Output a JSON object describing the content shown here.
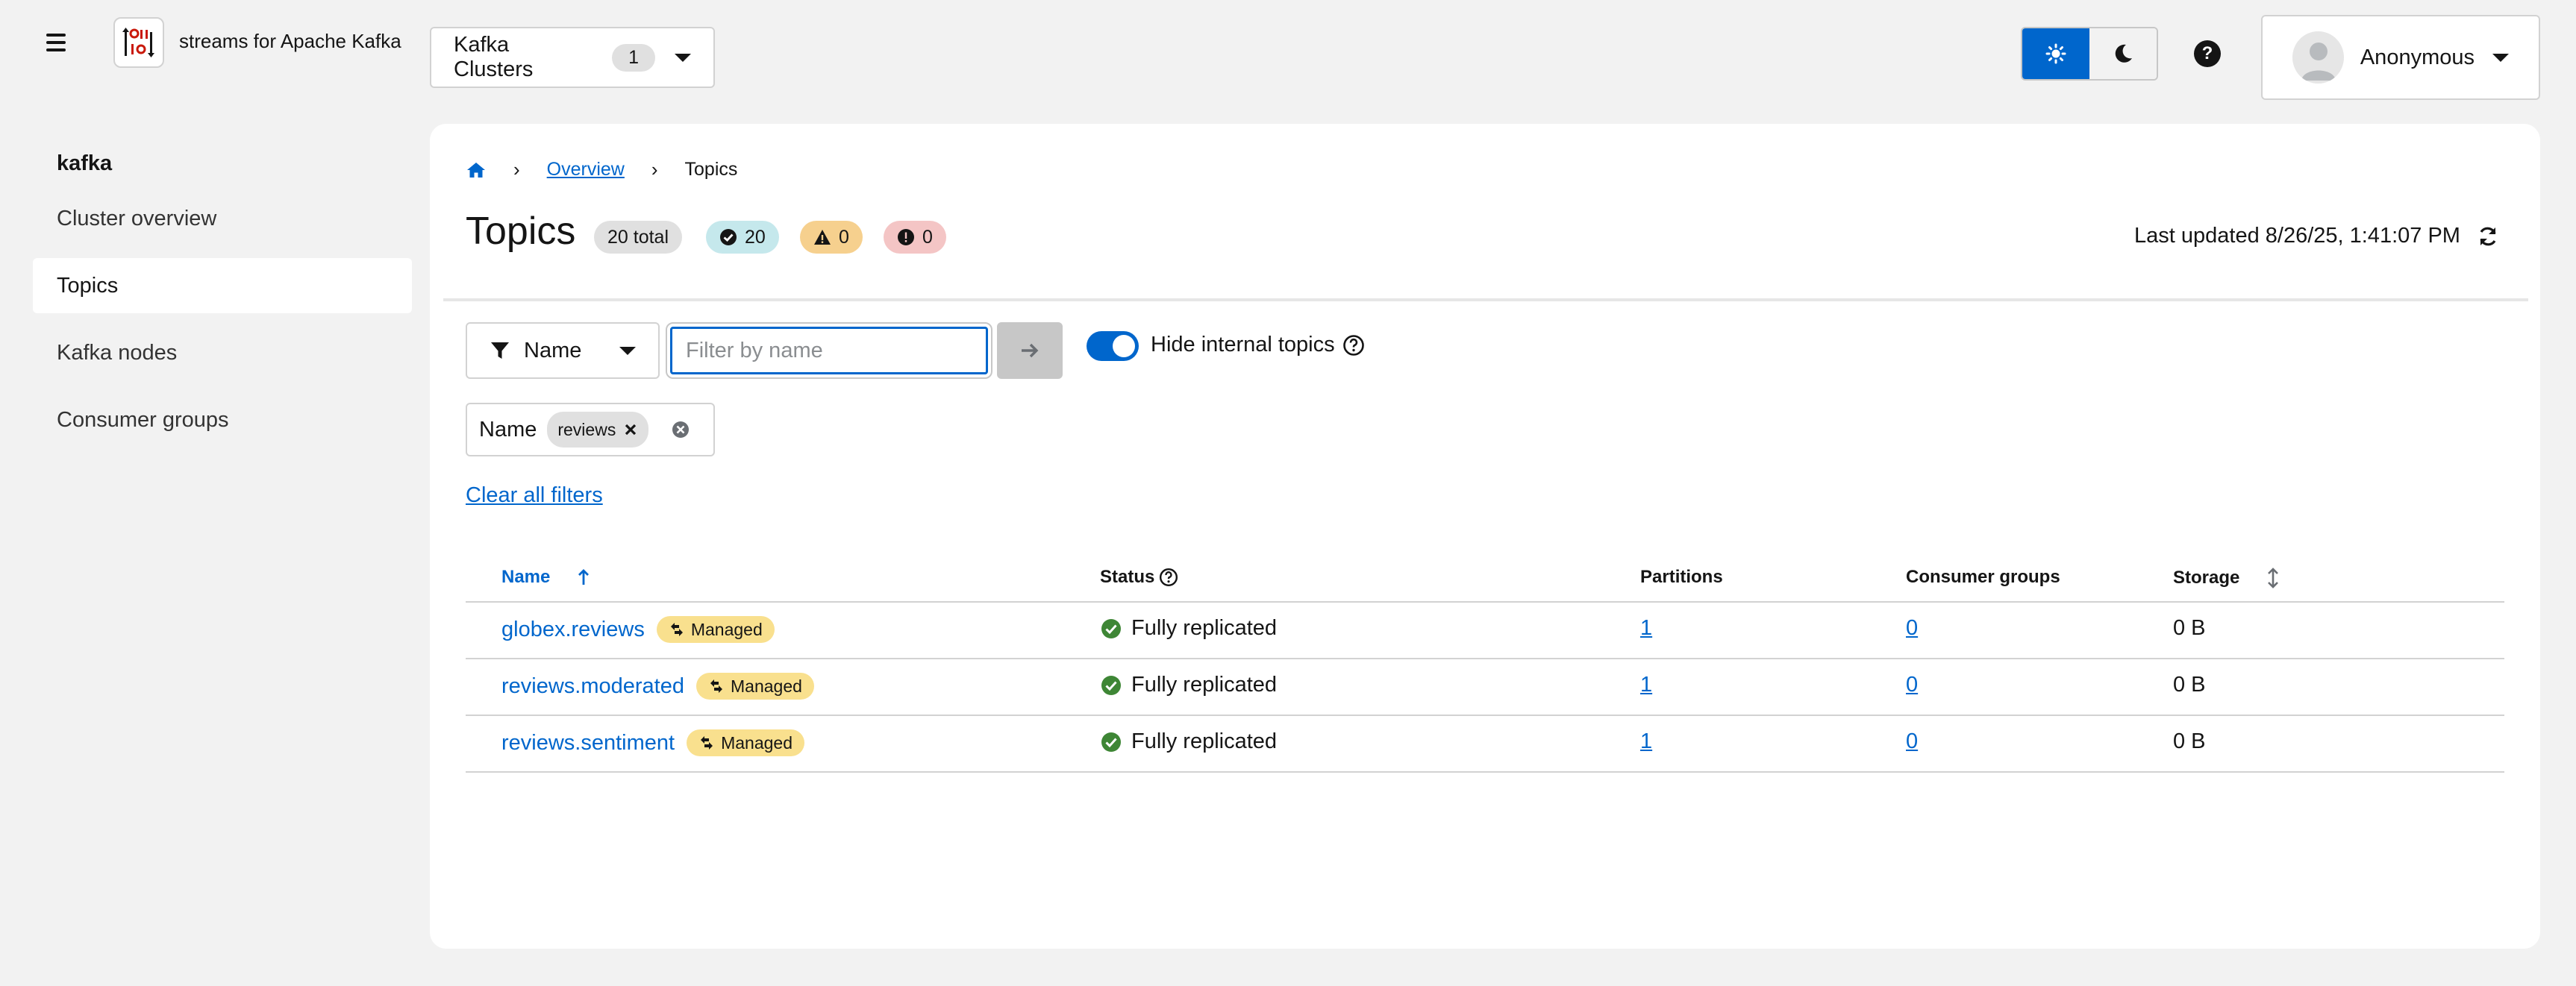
{
  "masthead": {
    "brand_text": "streams for Apache Kafka",
    "cluster_selector": {
      "label": "Kafka Clusters",
      "count": "1"
    },
    "user": {
      "name": "Anonymous"
    },
    "colors": {
      "accent": "#0066cc"
    }
  },
  "sidebar": {
    "title": "kafka",
    "items": [
      {
        "label": "Cluster overview"
      },
      {
        "label": "Topics"
      },
      {
        "label": "Kafka nodes"
      },
      {
        "label": "Consumer groups"
      }
    ]
  },
  "breadcrumb": {
    "overview": "Overview",
    "current": "Topics"
  },
  "header": {
    "title": "Topics",
    "total": "20 total",
    "ok_count": "20",
    "warn_count": "0",
    "err_count": "0",
    "last_updated": "Last updated 8/26/25, 1:41:07 PM"
  },
  "toolbar": {
    "filter_attribute": "Name",
    "filter_placeholder": "Filter by name",
    "hide_internal_label": "Hide internal topics",
    "chip_category": "Name",
    "chip_value": "reviews",
    "clear_all": "Clear all filters"
  },
  "table": {
    "columns": {
      "name": "Name",
      "status": "Status",
      "partitions": "Partitions",
      "consumer_groups": "Consumer groups",
      "storage": "Storage"
    },
    "managed_label": "Managed",
    "rows": [
      {
        "name": "globex.reviews",
        "status": "Fully replicated",
        "partitions": "1",
        "consumer_groups": "0",
        "storage": "0 B"
      },
      {
        "name": "reviews.moderated",
        "status": "Fully replicated",
        "partitions": "1",
        "consumer_groups": "0",
        "storage": "0 B"
      },
      {
        "name": "reviews.sentiment",
        "status": "Fully replicated",
        "partitions": "1",
        "consumer_groups": "0",
        "storage": "0 B"
      }
    ]
  }
}
